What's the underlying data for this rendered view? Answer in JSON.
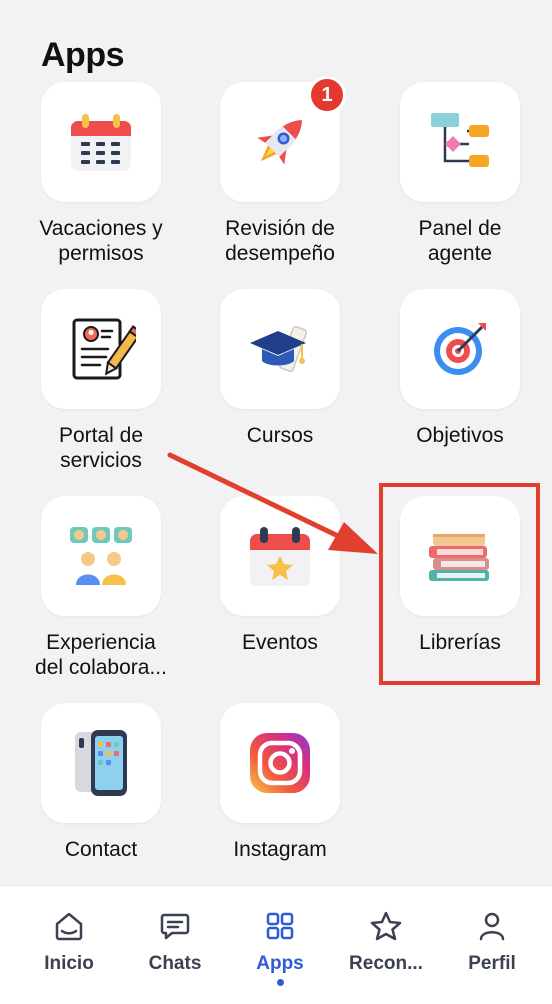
{
  "header": {
    "title": "Apps"
  },
  "apps": [
    {
      "label": "Vacaciones y\npermisos",
      "icon": "calendar-icon"
    },
    {
      "label": "Revisión de\ndesempeño",
      "icon": "rocket-icon",
      "badge": "1"
    },
    {
      "label": "Panel de\nagente",
      "icon": "flowchart-icon"
    },
    {
      "label": "Portal de\nservicios",
      "icon": "document-pen-icon"
    },
    {
      "label": "Cursos",
      "icon": "graduation-cap-icon"
    },
    {
      "label": "Objetivos",
      "icon": "target-icon"
    },
    {
      "label": "Experiencia\ndel  colabora...",
      "icon": "feedback-people-icon"
    },
    {
      "label": "Eventos",
      "icon": "event-calendar-star-icon"
    },
    {
      "label": "Librerías",
      "icon": "books-icon"
    },
    {
      "label": "Contact",
      "icon": "phone-icon"
    },
    {
      "label": "Instagram",
      "icon": "instagram-icon"
    }
  ],
  "bottom_nav": {
    "items": [
      {
        "label": "Inicio",
        "icon": "home-icon"
      },
      {
        "label": "Chats",
        "icon": "chat-icon"
      },
      {
        "label": "Apps",
        "icon": "apps-grid-icon",
        "active": true
      },
      {
        "label": "Recon...",
        "icon": "star-icon"
      },
      {
        "label": "Perfil",
        "icon": "person-icon"
      }
    ]
  },
  "colors": {
    "background": "#f2f2f4",
    "active_nav": "#2f5bd8",
    "badge": "#e23a2e",
    "annotation": "#e2402f"
  }
}
